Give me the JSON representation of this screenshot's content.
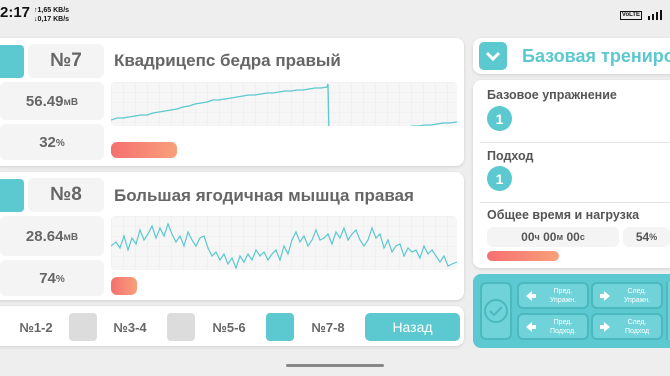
{
  "status": {
    "time": "2:17",
    "net_up": "1,65",
    "net_up_unit": "KB/s",
    "net_down": "0,17",
    "net_down_unit": "KB/s",
    "volte": "VoLTE"
  },
  "sensors": [
    {
      "number": "№7",
      "name": "Квадрицепс бедра правый",
      "value": "56.49",
      "value_unit": "мВ",
      "percent": "32",
      "percent_unit": "%",
      "progress": 0.18
    },
    {
      "number": "№8",
      "name": "Большая ягодичная мышца правая",
      "value": "28.64",
      "value_unit": "мВ",
      "percent": "74",
      "percent_unit": "%",
      "progress": 0.08
    }
  ],
  "pager": {
    "items": [
      "№1-2",
      "№3-4",
      "№5-6",
      "№7-8"
    ],
    "active": "№7-8",
    "back_label": "Назад"
  },
  "training": {
    "title": "Базовая трениров",
    "base_exercise_label": "Базовое упражнение",
    "base_exercise_value": "1",
    "approach_label": "Подход",
    "approach_value": "1",
    "total_label": "Общее время и нагрузка",
    "time_h": "00",
    "time_h_unit": "ч",
    "time_m": "00",
    "time_m_unit": "м",
    "time_s": "00",
    "time_s_unit": "с",
    "load_percent": "54",
    "load_percent_unit": "%"
  },
  "controls": {
    "prev_exercise": "Пред. Упражн.",
    "next_exercise": "След. Упражн.",
    "prev_approach": "Пред. Подход.",
    "next_approach": "След. Подход"
  },
  "colors": {
    "accent": "#5cc8cf",
    "progress_start": "#f57070",
    "progress_end": "#f8a07a"
  }
}
